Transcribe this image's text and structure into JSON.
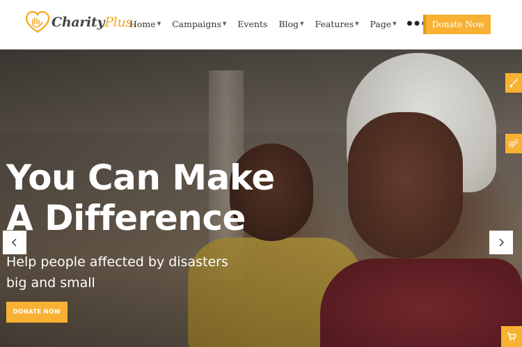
{
  "header": {
    "logo": {
      "name": "Charity",
      "suffix": "Plus.",
      "icon": "heart-hand-icon"
    },
    "nav": [
      {
        "label": "Home",
        "has_dropdown": true
      },
      {
        "label": "Campaigns",
        "has_dropdown": true
      },
      {
        "label": "Events",
        "has_dropdown": false
      },
      {
        "label": "Blog",
        "has_dropdown": true
      },
      {
        "label": "Features",
        "has_dropdown": true
      },
      {
        "label": "Page",
        "has_dropdown": true
      }
    ],
    "more_icon": "more-dots-icon",
    "donate_label": "Donate Now"
  },
  "hero": {
    "title": "You Can Make A Difference",
    "subtitle": "Help people affected by disasters big and small",
    "cta_label": "DONATE NOW",
    "prev_icon": "chevron-left-icon",
    "next_icon": "chevron-right-icon"
  },
  "side_tools": [
    {
      "icon": "brush-icon"
    },
    {
      "icon": "gear-icon"
    },
    {
      "icon": "cart-icon"
    }
  ],
  "colors": {
    "accent": "#f8b133",
    "accent_dark": "#e69714",
    "nav_text": "#333333",
    "hero_text": "#ffffff"
  }
}
